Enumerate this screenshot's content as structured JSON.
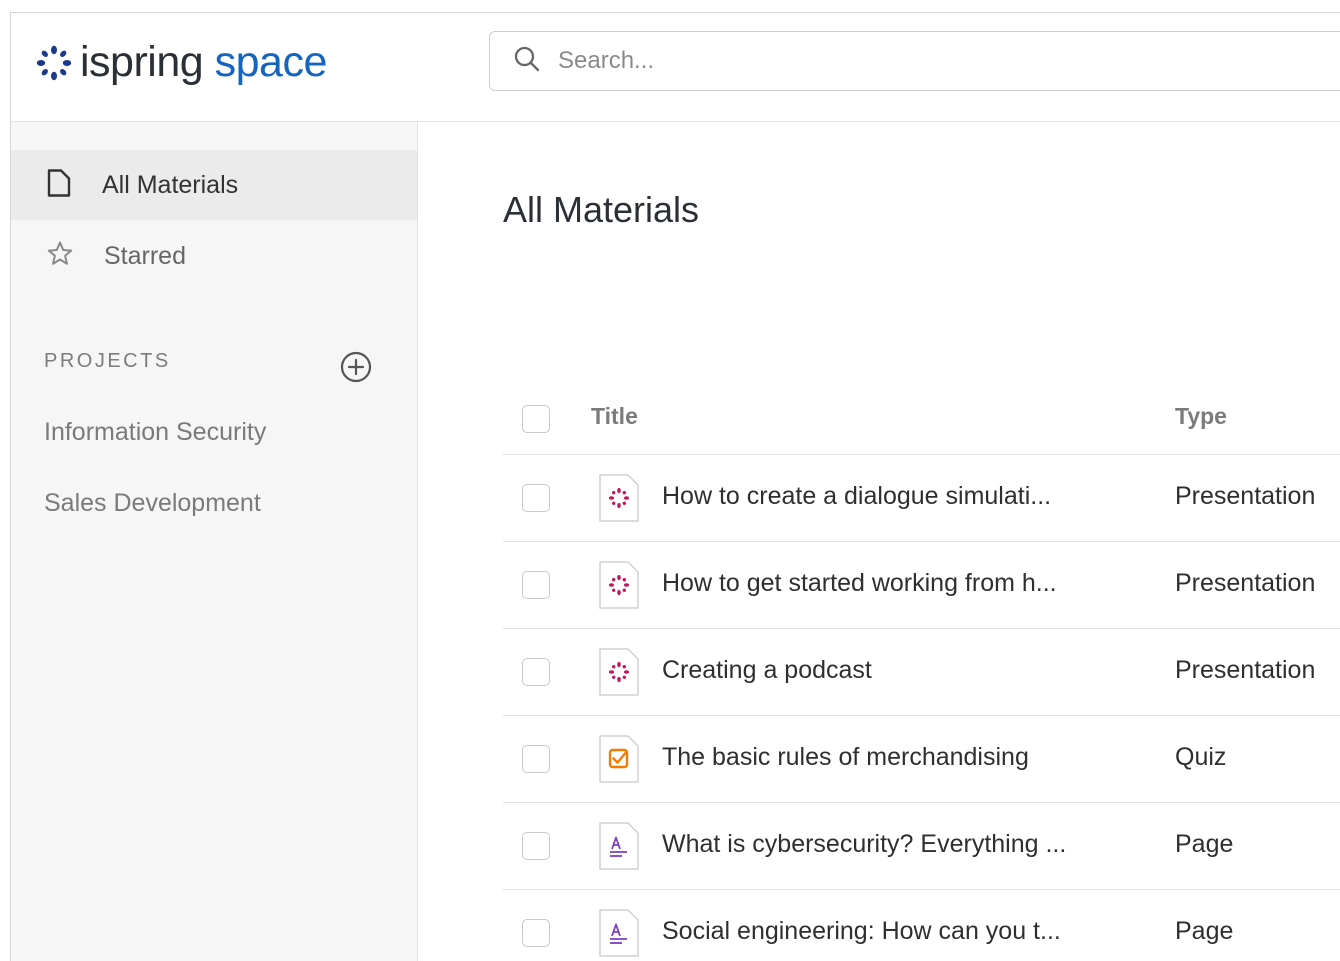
{
  "logo": {
    "word1": "ispring",
    "word2": "space"
  },
  "colors": {
    "brand_dots": "#1a3a8a",
    "brand_space": "#1565c0",
    "presentation_icon": "#c2185b",
    "quiz_icon": "#f57c00",
    "page_icon": "#7b3fbf"
  },
  "search": {
    "placeholder": "Search..."
  },
  "sidebar": {
    "nav": [
      {
        "label": "All Materials",
        "icon": "file-icon",
        "active": true
      },
      {
        "label": "Starred",
        "icon": "star-icon",
        "active": false
      }
    ],
    "projects_heading": "PROJECTS",
    "projects": [
      {
        "label": "Information Security"
      },
      {
        "label": "Sales Development"
      }
    ]
  },
  "main": {
    "title": "All Materials",
    "table": {
      "columns": {
        "title": "Title",
        "type": "Type"
      },
      "rows": [
        {
          "title": "How to create a dialogue simulati...",
          "type": "Presentation",
          "icon": "presentation-icon"
        },
        {
          "title": "How to get started working from h...",
          "type": "Presentation",
          "icon": "presentation-icon"
        },
        {
          "title": "Creating a podcast",
          "type": "Presentation",
          "icon": "presentation-icon"
        },
        {
          "title": "The basic rules of merchandising",
          "type": "Quiz",
          "icon": "quiz-icon"
        },
        {
          "title": "What is cybersecurity? Everything ...",
          "type": "Page",
          "icon": "page-icon"
        },
        {
          "title": "Social engineering: How can you t...",
          "type": "Page",
          "icon": "page-icon"
        }
      ]
    }
  }
}
